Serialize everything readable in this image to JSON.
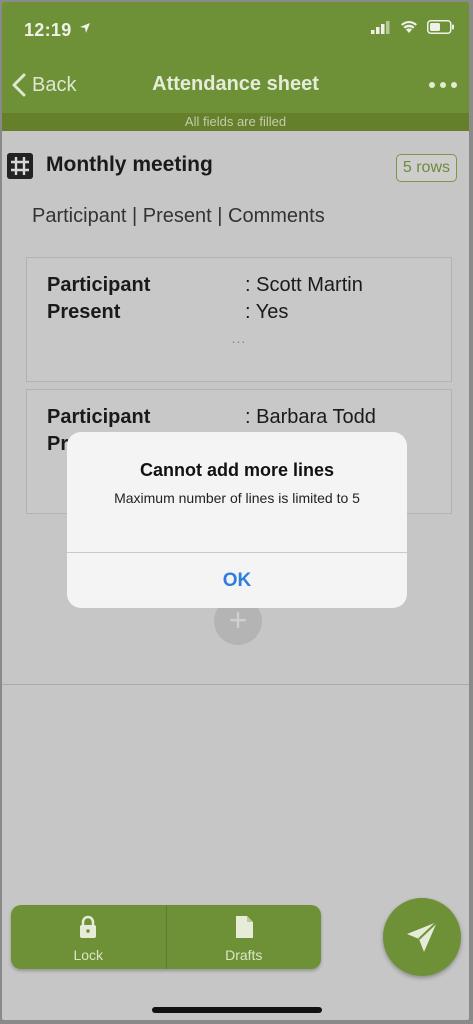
{
  "status": {
    "time": "12:19"
  },
  "nav": {
    "back_label": "Back",
    "title": "Attendance sheet"
  },
  "banner": {
    "text": "All fields are filled"
  },
  "section": {
    "title": "Monthly meeting",
    "rows_badge": "5 rows",
    "columns": "Participant | Present | Comments"
  },
  "cards": [
    {
      "rows": [
        {
          "key": "Participant",
          "value": ": Scott Martin"
        },
        {
          "key": "Present",
          "value": ": Yes"
        }
      ],
      "ellipsis": "..."
    },
    {
      "rows": [
        {
          "key": "Participant",
          "value": ": Barbara Todd"
        },
        {
          "key": "Pr",
          "value": ""
        }
      ]
    }
  ],
  "add_button": {
    "glyph": "+"
  },
  "toolbar": {
    "lock_label": "Lock",
    "drafts_label": "Drafts"
  },
  "alert": {
    "title": "Cannot add more lines",
    "message": "Maximum number of lines is limited to 5",
    "ok_label": "OK"
  },
  "colors": {
    "primary": "#6e9138",
    "banner": "#667f2b",
    "link": "#2f7de1"
  },
  "icons": [
    "location-arrow-icon",
    "signal-icon",
    "wifi-icon",
    "battery-icon",
    "chevron-left-icon",
    "more-icon",
    "table-grid-icon",
    "plus-icon",
    "lock-icon",
    "document-icon",
    "send-icon"
  ]
}
